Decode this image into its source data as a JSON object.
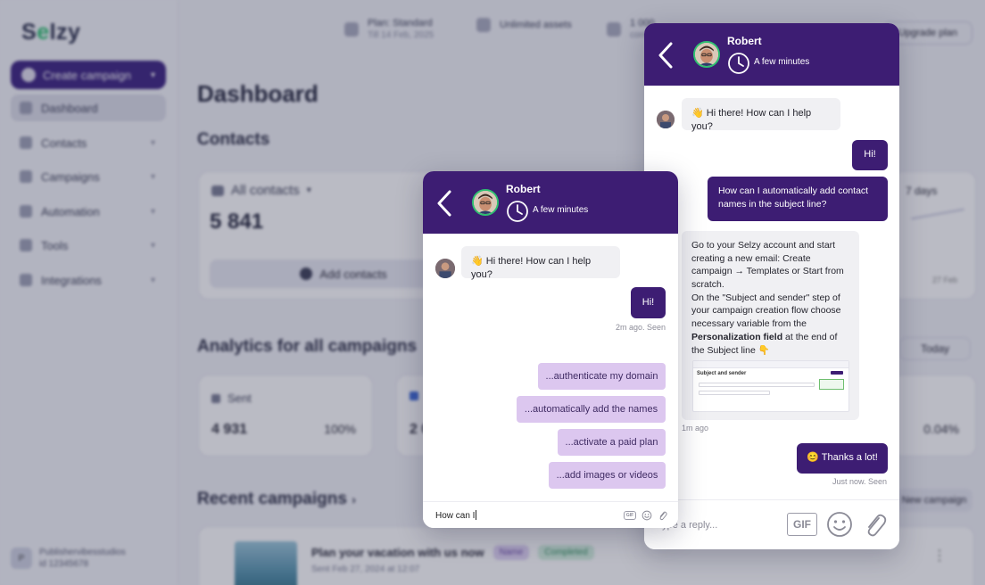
{
  "dashboard": {
    "logo": {
      "text": "Selzy",
      "accent": "#2fbf71"
    },
    "sidebar": {
      "create_label": "Create campaign",
      "items": [
        {
          "label": "Dashboard",
          "icon": "home-icon",
          "active": true
        },
        {
          "label": "Contacts",
          "icon": "contacts-icon"
        },
        {
          "label": "Campaigns",
          "icon": "campaigns-icon"
        },
        {
          "label": "Automation",
          "icon": "automation-icon"
        },
        {
          "label": "Tools",
          "icon": "tools-icon"
        },
        {
          "label": "Integrations",
          "icon": "integrations-icon"
        }
      ],
      "account_name": "Publishervibesstudios",
      "account_id": "id 12345678"
    },
    "topbar": {
      "plan_label": "Plan: Standard",
      "plan_sub": "Till 14 Feb, 2025",
      "assets_label": "Unlimited assets",
      "contacts_label": "1 000",
      "contacts_sub": "contacts",
      "upgrade_label": "Upgrade plan"
    },
    "title": "Dashboard",
    "contacts_heading": "Contacts",
    "all_contacts_label": "All contacts",
    "contacts_total": "5 841",
    "add_contacts_label": "Add contacts",
    "range_label": "7 days",
    "range_date": "27 Feb",
    "analytics_heading": "Analytics for all campaigns",
    "today_label": "Today",
    "stats": [
      {
        "label": "Sent",
        "value": "4 931",
        "pct": "100%"
      },
      {
        "label": "",
        "value": "2 0",
        "pct": ""
      },
      {
        "label": "",
        "value": "",
        "pct": "0.04%"
      }
    ],
    "recent_heading": "Recent campaigns",
    "new_campaign_label": "New campaign",
    "campaign": {
      "title": "Plan your vacation with us now",
      "tag": "Name",
      "status": "Completed",
      "sent": "Sent Feb 27, 2024 at 12:07"
    }
  },
  "chat_front": {
    "agent_name": "Robert",
    "status": "A few minutes",
    "greeting": "👋 Hi there! How can I help you?",
    "user_message": "Hi!",
    "user_meta": "2m ago. Seen",
    "quick_replies": [
      "...authenticate my domain",
      "...automatically add the names",
      "...activate a paid plan",
      "...add images or videos"
    ],
    "input_value": "How can I",
    "gif_label": "GIF"
  },
  "chat_back": {
    "agent_name": "Robert",
    "status": "A few minutes",
    "greeting": "👋 Hi there! How can I help you?",
    "user_message_1": "Hi!",
    "user_message_2": "How can I automatically add contact names in the subject line?",
    "answer_part1": "Go to your Selzy account and start creating a new email: Create campaign → Templates or Start from scratch.",
    "answer_part2": "On the \"Subject and sender\" step of your campaign creation flow choose necessary variable from the",
    "answer_bold": "Personalization field",
    "answer_part3": "at the end of the Subject line 👇",
    "answer_meta": "1m ago",
    "screenshot_title": "Subject and sender",
    "thanks_message": "😊 Thanks a lot!",
    "thanks_meta": "Just now. Seen",
    "input_placeholder": "Type a reply...",
    "gif_label": "GIF"
  },
  "colors": {
    "brand_purple": "#3d1d73",
    "quick_reply_bg": "#dcc7ef",
    "online_green": "#2fbf71"
  }
}
